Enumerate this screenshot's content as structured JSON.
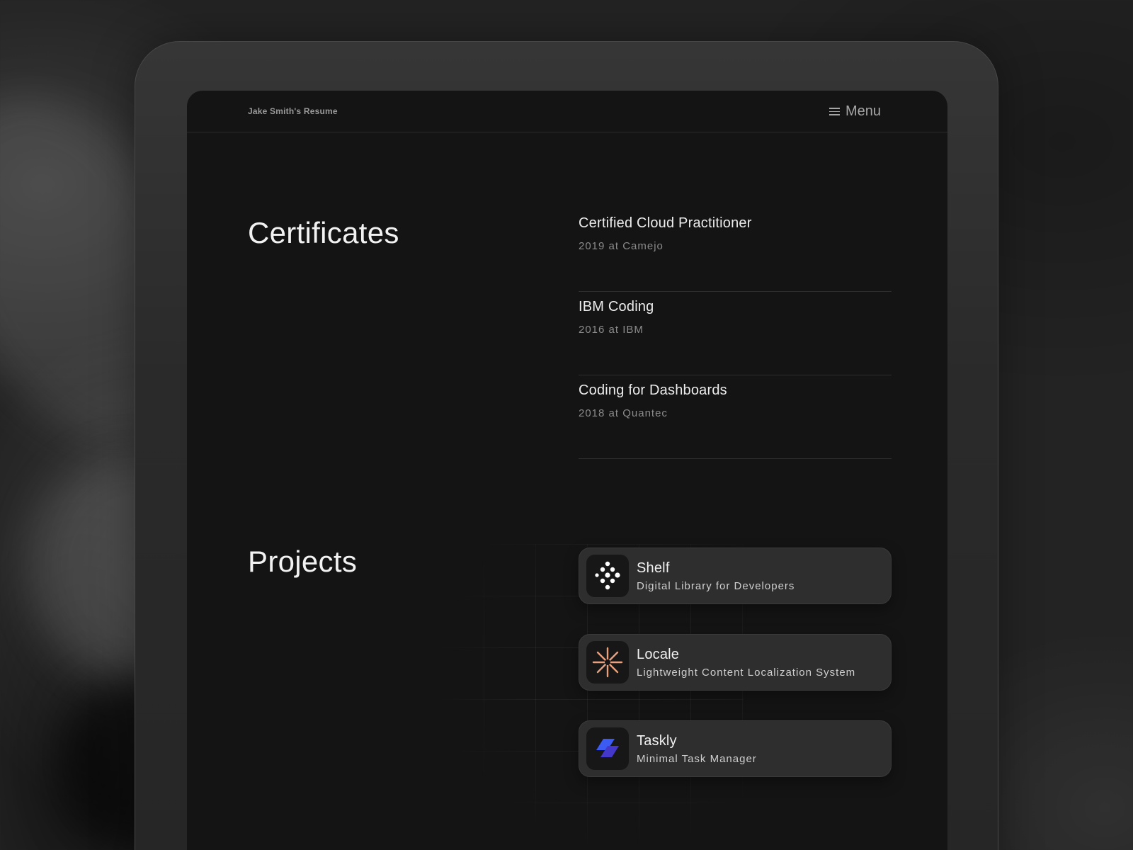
{
  "header": {
    "brand": "Jake Smith's Resume",
    "menu_label": "Menu",
    "menu_icon": "hamburger-icon"
  },
  "certificates": {
    "title": "Certificates",
    "items": [
      {
        "name": "Certified Cloud Practitioner",
        "meta": "2019 at Camejo"
      },
      {
        "name": "IBM Coding",
        "meta": "2016 at IBM"
      },
      {
        "name": "Coding for Dashboards",
        "meta": "2018 at Quantec"
      }
    ]
  },
  "projects": {
    "title": "Projects",
    "items": [
      {
        "name": "Shelf",
        "description": "Digital Library for Developers",
        "icon": "shelf-dots-icon",
        "icon_color": "#ffffff"
      },
      {
        "name": "Locale",
        "description": "Lightweight Content Localization System",
        "icon": "locale-asterisk-icon",
        "icon_color": "#e8a07e"
      },
      {
        "name": "Taskly",
        "description": "Minimal Task Manager",
        "icon": "taskly-layers-icon",
        "icon_color": "#4f46e5"
      }
    ]
  },
  "colors": {
    "background": "#232323",
    "screen": "#141414",
    "card": "#2e2e2e",
    "accent_orange": "#e8a07e",
    "accent_blue": "#4f46e5"
  }
}
